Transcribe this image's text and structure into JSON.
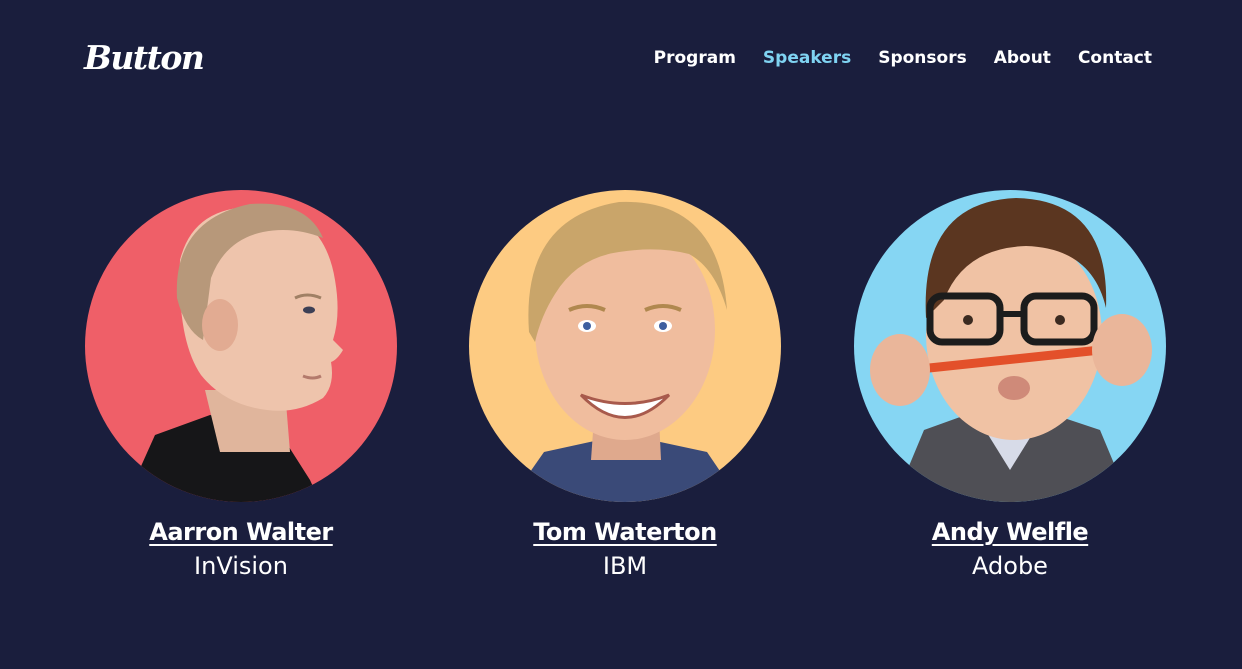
{
  "header": {
    "logo_text": "Button",
    "nav": [
      {
        "label": "Program",
        "active": false
      },
      {
        "label": "Speakers",
        "active": true
      },
      {
        "label": "Sponsors",
        "active": false
      },
      {
        "label": "About",
        "active": false
      },
      {
        "label": "Contact",
        "active": false
      }
    ]
  },
  "speakers": [
    {
      "name": "Aarron Walter",
      "company": "InVision",
      "bg_color": "#ef5f68"
    },
    {
      "name": "Tom Waterton",
      "company": "IBM",
      "bg_color": "#fdcb82"
    },
    {
      "name": "Andy Welfle",
      "company": "Adobe",
      "bg_color": "#86d6f3"
    }
  ],
  "colors": {
    "background": "#1a1e3d",
    "text": "#ffffff",
    "accent": "#7fd3f2"
  }
}
